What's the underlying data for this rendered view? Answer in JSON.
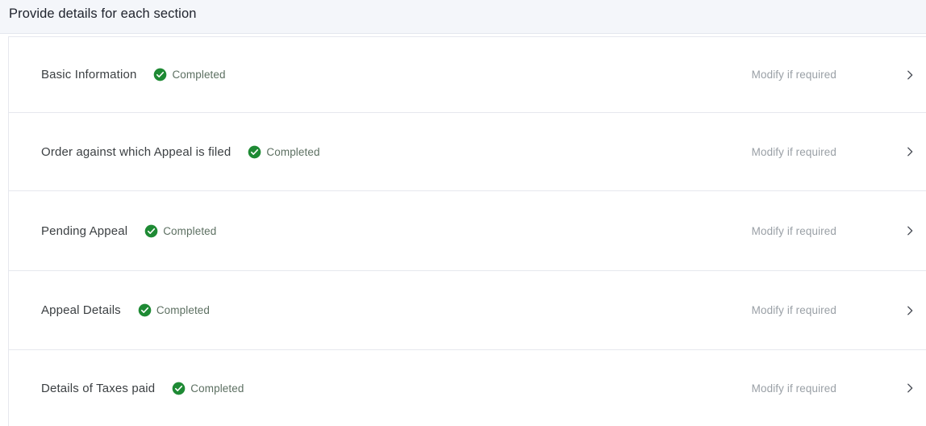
{
  "header": {
    "title": "Provide details for each section",
    "background_color": "#f4f6fa"
  },
  "theme": {
    "completed_icon_color": "#1e8a34",
    "completed_text_color": "#5d7062",
    "modify_text_color": "#9aa0a6",
    "section_label_color": "#3c4043",
    "divider_color": "#e6e8ee",
    "card_background": "#ffffff"
  },
  "sections": [
    {
      "label": "Basic Information",
      "status": "Completed",
      "status_icon": "check-circle-icon",
      "action_label": "Modify if required",
      "chevron_icon": "chevron-right-icon",
      "height": 94
    },
    {
      "label": "Order against which Appeal is filed",
      "status": "Completed",
      "status_icon": "check-circle-icon",
      "action_label": "Modify if required",
      "chevron_icon": "chevron-right-icon",
      "height": 97
    },
    {
      "label": "Pending Appeal",
      "status": "Completed",
      "status_icon": "check-circle-icon",
      "action_label": "Modify if required",
      "chevron_icon": "chevron-right-icon",
      "height": 99
    },
    {
      "label": "Appeal Details",
      "status": "Completed",
      "status_icon": "check-circle-icon",
      "action_label": "Modify if required",
      "chevron_icon": "chevron-right-icon",
      "height": 98
    },
    {
      "label": "Details of Taxes paid",
      "status": "Completed",
      "status_icon": "check-circle-icon",
      "action_label": "Modify if required",
      "chevron_icon": "chevron-right-icon",
      "height": 94
    }
  ]
}
